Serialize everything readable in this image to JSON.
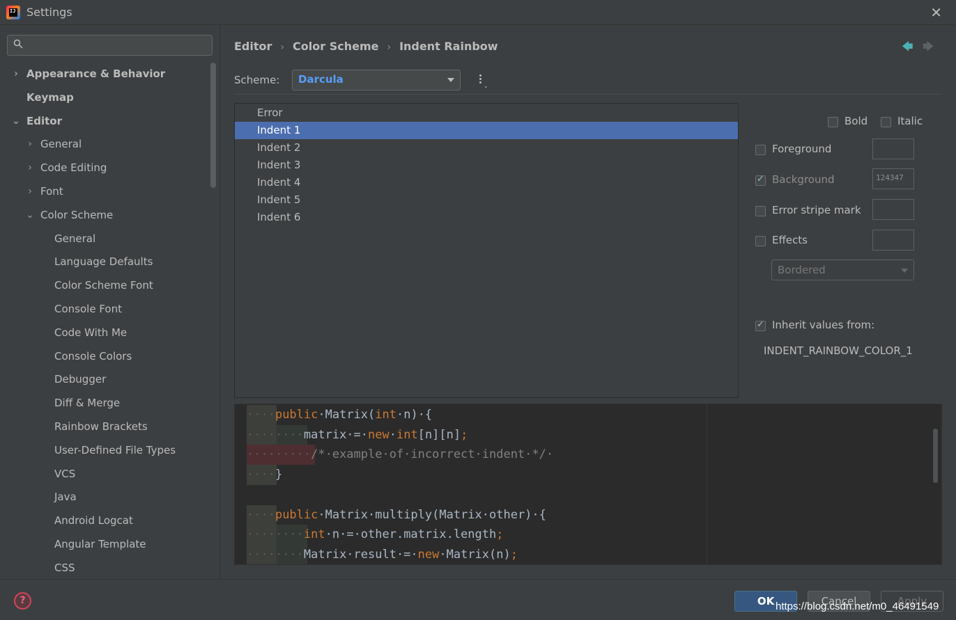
{
  "window": {
    "title": "Settings",
    "app_icon_text": "IJ",
    "close_icon": "✕"
  },
  "search": {
    "placeholder": "",
    "value": ""
  },
  "sidebar": {
    "items": [
      {
        "label": "Appearance & Behavior",
        "level": 0,
        "arrow": "›",
        "bold": true
      },
      {
        "label": "Keymap",
        "level": 0,
        "arrow": "",
        "bold": true
      },
      {
        "label": "Editor",
        "level": 0,
        "arrow": "⌄",
        "bold": true
      },
      {
        "label": "General",
        "level": 1,
        "arrow": "›"
      },
      {
        "label": "Code Editing",
        "level": 1,
        "arrow": "›"
      },
      {
        "label": "Font",
        "level": 1,
        "arrow": "›"
      },
      {
        "label": "Color Scheme",
        "level": 1,
        "arrow": "⌄"
      },
      {
        "label": "General",
        "level": 2
      },
      {
        "label": "Language Defaults",
        "level": 2
      },
      {
        "label": "Color Scheme Font",
        "level": 2
      },
      {
        "label": "Console Font",
        "level": 2
      },
      {
        "label": "Code With Me",
        "level": 2
      },
      {
        "label": "Console Colors",
        "level": 2
      },
      {
        "label": "Debugger",
        "level": 2
      },
      {
        "label": "Diff & Merge",
        "level": 2
      },
      {
        "label": "Rainbow Brackets",
        "level": 2
      },
      {
        "label": "User-Defined File Types",
        "level": 2
      },
      {
        "label": "VCS",
        "level": 2
      },
      {
        "label": "Java",
        "level": 2
      },
      {
        "label": "Android Logcat",
        "level": 2
      },
      {
        "label": "Angular Template",
        "level": 2
      },
      {
        "label": "CSS",
        "level": 2
      }
    ]
  },
  "breadcrumb": [
    "Editor",
    "Color Scheme",
    "Indent Rainbow"
  ],
  "breadcrumb_sep": "›",
  "nav": {
    "back_icon": "🡄",
    "forward_icon": "🡆"
  },
  "scheme": {
    "label": "Scheme:",
    "value": "Darcula"
  },
  "attributes": {
    "items": [
      "Error",
      "Indent 1",
      "Indent 2",
      "Indent 3",
      "Indent 4",
      "Indent 5",
      "Indent 6"
    ],
    "selected_index": 1
  },
  "properties": {
    "bold_label": "Bold",
    "italic_label": "Italic",
    "foreground_label": "Foreground",
    "background_label": "Background",
    "background_code": "124347",
    "error_stripe_label": "Error stripe mark",
    "effects_label": "Effects",
    "effects_value": "Bordered",
    "inherit_label": "Inherit values from:",
    "inherit_value": "INDENT_RAINBOW_COLOR_1",
    "bold_checked": false,
    "italic_checked": false,
    "foreground_checked": false,
    "background_checked": true,
    "error_stripe_checked": false,
    "effects_checked": false,
    "inherit_checked": true
  },
  "preview": {
    "lines": [
      {
        "indent_dots": "····",
        "parts": [
          [
            "kw",
            "public"
          ],
          [
            "",
            "·Matrix("
          ],
          [
            "kw",
            "int"
          ],
          [
            "",
            "·n)·{"
          ]
        ]
      },
      {
        "indent_dots": "········",
        "parts": [
          [
            "",
            "matrix·=·"
          ],
          [
            "kw",
            "new"
          ],
          [
            "",
            "·"
          ],
          [
            "kw",
            "int"
          ],
          [
            "",
            "[n][n]"
          ],
          [
            "kw",
            ";"
          ]
        ]
      },
      {
        "indent_dots": "·········",
        "parts": [
          [
            "cm",
            "/*·example·of·incorrect·indent·*/·"
          ]
        ]
      },
      {
        "indent_dots": "····",
        "parts": [
          [
            "",
            "}"
          ]
        ]
      },
      {
        "indent_dots": "",
        "parts": []
      },
      {
        "indent_dots": "····",
        "parts": [
          [
            "kw",
            "public"
          ],
          [
            "",
            "·Matrix·multiply(Matrix·other)·{"
          ]
        ]
      },
      {
        "indent_dots": "········",
        "parts": [
          [
            "kw",
            "int"
          ],
          [
            "",
            "·n·=·other.matrix.length"
          ],
          [
            "kw",
            ";"
          ]
        ]
      },
      {
        "indent_dots": "········",
        "parts": [
          [
            "",
            "Matrix·result·=·"
          ],
          [
            "kw",
            "new"
          ],
          [
            "",
            "·Matrix(n)"
          ],
          [
            "kw",
            ";"
          ]
        ]
      }
    ]
  },
  "footer": {
    "help_icon": "?",
    "ok_label": "OK",
    "cancel_label": "Cancel",
    "apply_label": "Apply",
    "watermark": "https://blog.csdn.net/m0_46491549"
  }
}
